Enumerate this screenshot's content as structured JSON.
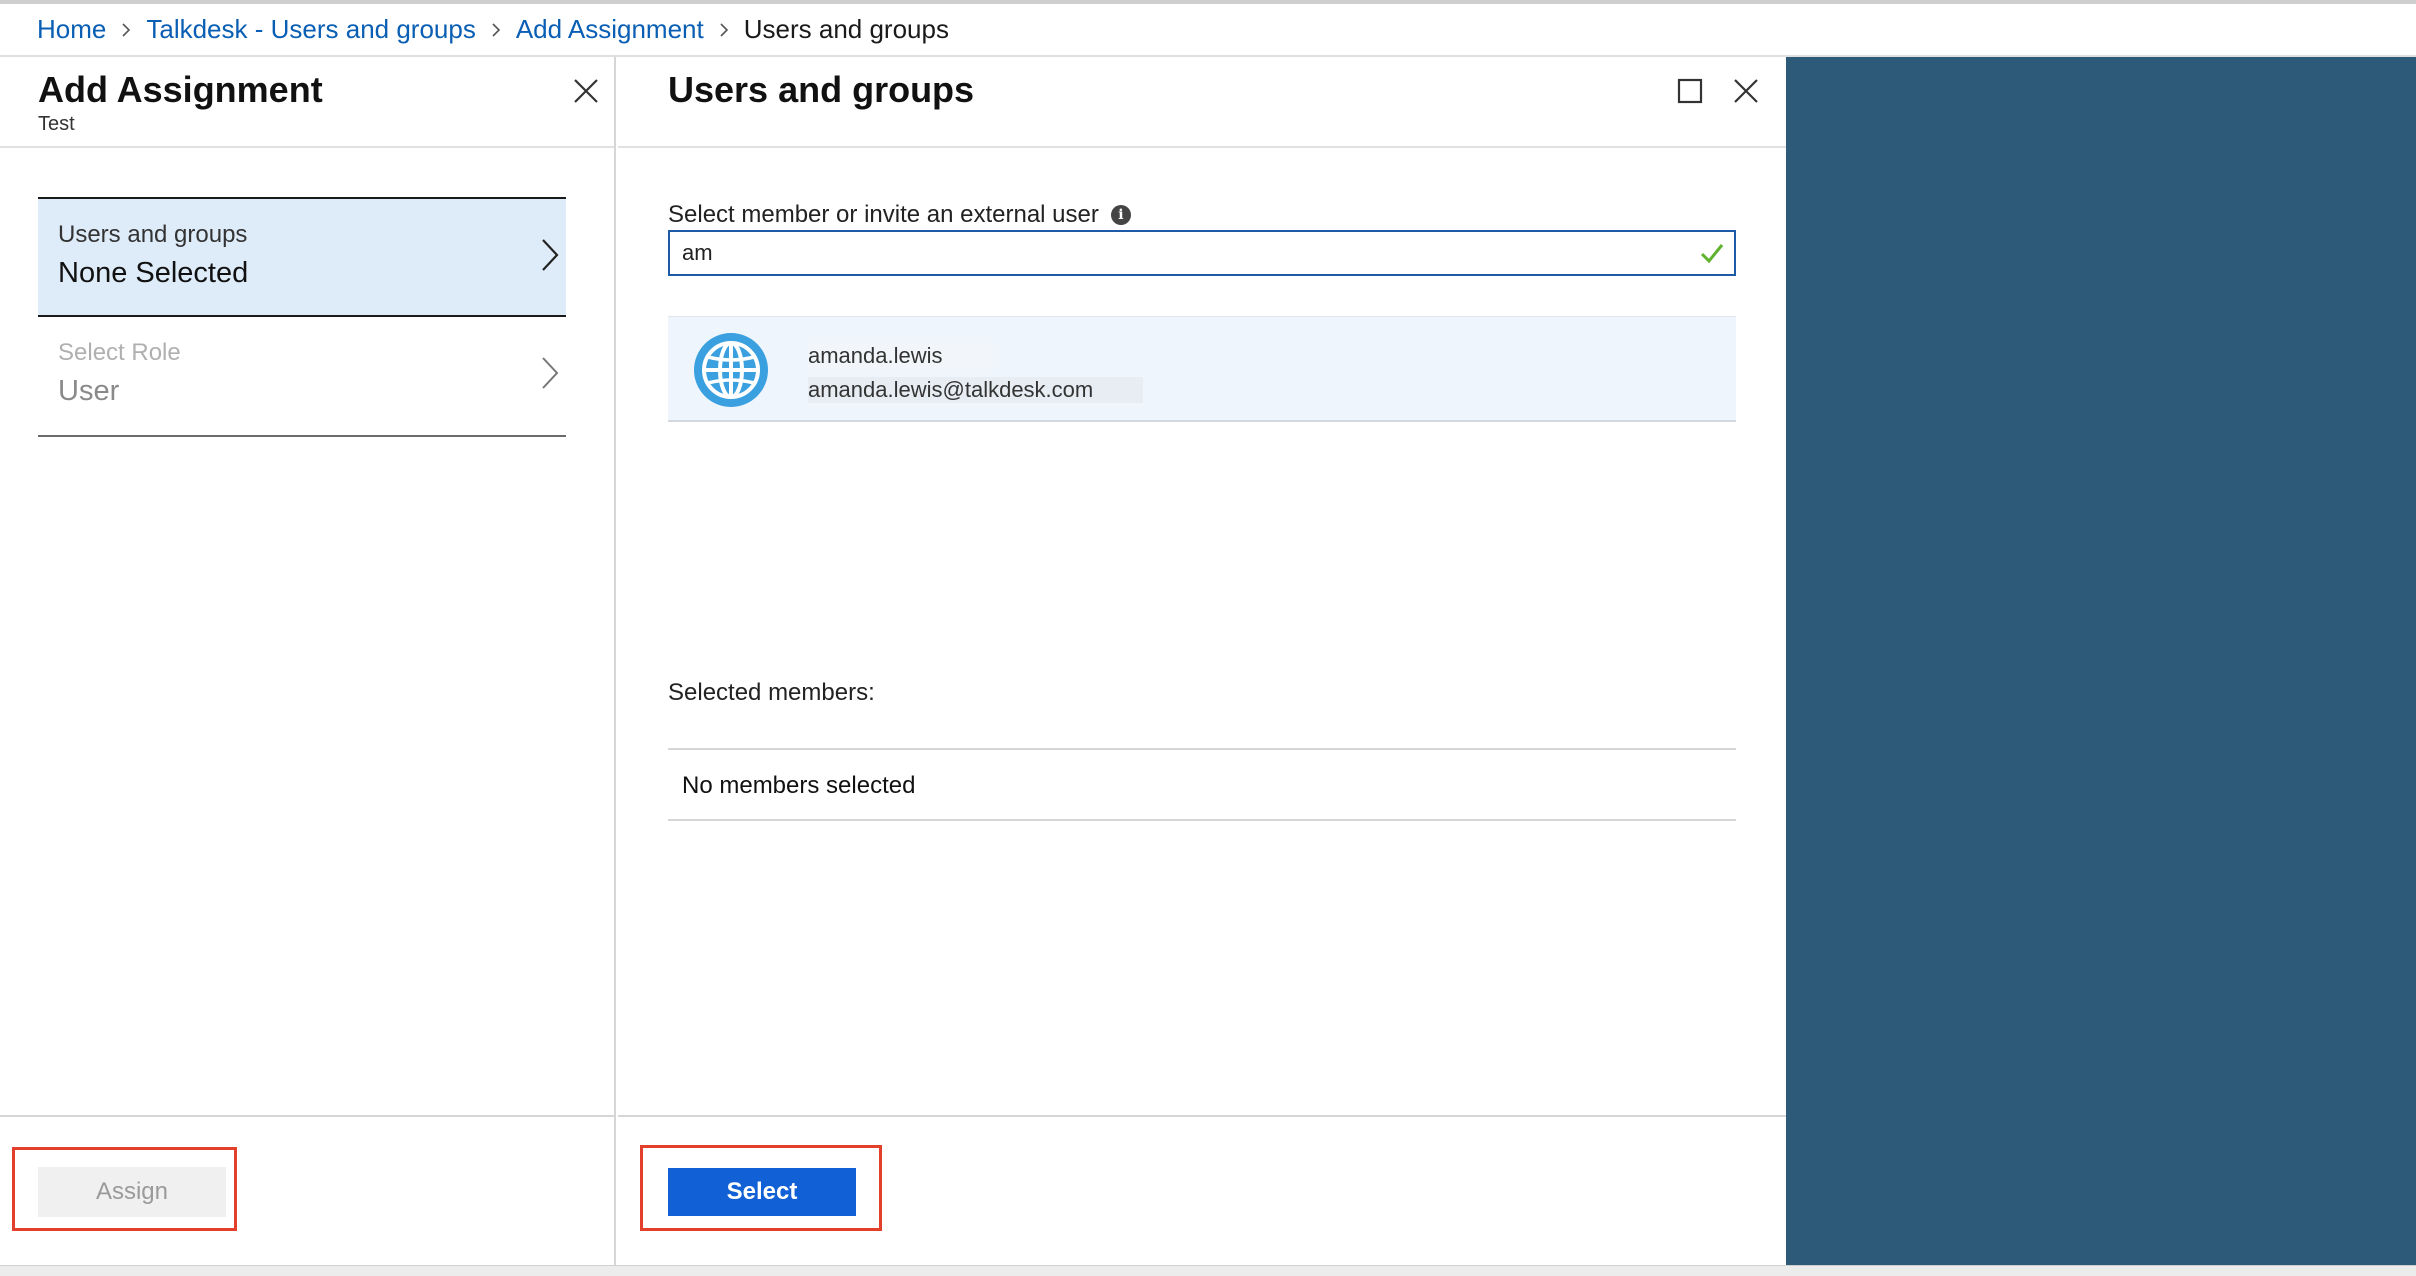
{
  "breadcrumb": {
    "items": [
      {
        "label": "Home",
        "link": true
      },
      {
        "label": "Talkdesk - Users and groups",
        "link": true
      },
      {
        "label": "Add Assignment",
        "link": true
      },
      {
        "label": "Users and groups",
        "link": false
      }
    ]
  },
  "add_assignment": {
    "title": "Add Assignment",
    "subtitle": "Test",
    "users_groups": {
      "label": "Users and groups",
      "value": "None Selected"
    },
    "role": {
      "label": "Select Role",
      "value": "User"
    },
    "assign_label": "Assign"
  },
  "users_groups_blade": {
    "title": "Users and groups",
    "search_label": "Select member or invite an external user",
    "search_value": "am",
    "results": [
      {
        "name": "amanda.lewis",
        "email": "amanda.lewis@talkdesk.com"
      }
    ],
    "selected_label": "Selected members:",
    "no_members": "No members selected",
    "select_label": "Select"
  },
  "colors": {
    "link": "#0a5fb4",
    "primary_button": "#1160d6",
    "highlight": "#e2402a",
    "side_panel": "#2e5a7a",
    "active_selector": "#deecf9"
  },
  "icons": [
    "chevron-right-icon",
    "close-icon",
    "maximize-icon",
    "info-icon",
    "checkmark-icon",
    "globe-icon"
  ]
}
